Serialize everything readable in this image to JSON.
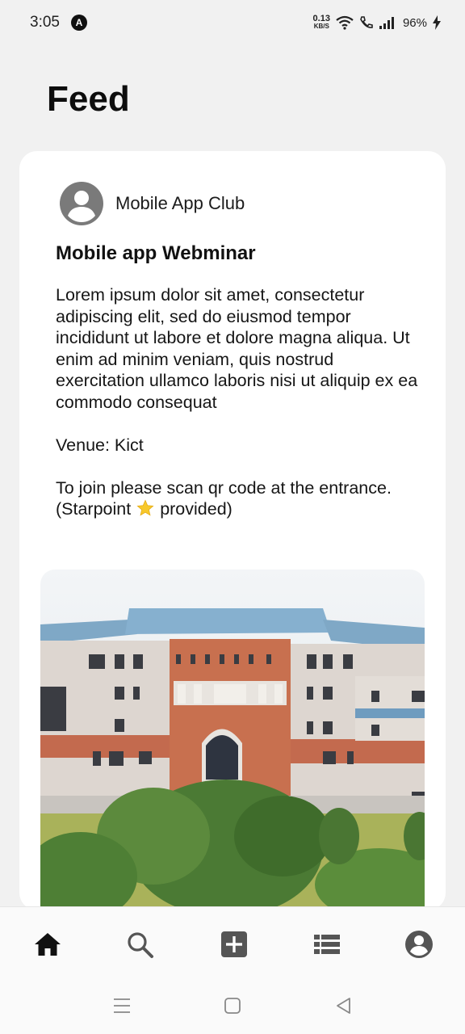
{
  "status_bar": {
    "time": "3:05",
    "app_badge": "A",
    "net_speed_value": "0.13",
    "net_speed_unit": "KB/S",
    "battery": "96%"
  },
  "page": {
    "title": "Feed"
  },
  "post": {
    "author": "Mobile App Club",
    "title": "Mobile app Webminar",
    "body": "Lorem ipsum dolor sit amet, consectetur adipiscing elit, sed do eiusmod tempor incididunt ut labore et dolore magna aliqua. Ut enim ad minim veniam, quis nostrud exercitation ullamco laboris nisi ut aliquip ex ea commodo consequat",
    "venue": "Venue: Kict",
    "join_text": "To join please scan qr code at the entrance.",
    "starpoint_before": "(Starpoint",
    "starpoint_after": "provided)",
    "star_icon": "star-emoji"
  },
  "bottom_nav": {
    "items": [
      {
        "icon": "home-icon",
        "active": true
      },
      {
        "icon": "search-icon",
        "active": false
      },
      {
        "icon": "add-box-icon",
        "active": false
      },
      {
        "icon": "list-icon",
        "active": false
      },
      {
        "icon": "account-icon",
        "active": false
      }
    ]
  },
  "system_nav": [
    "menu-icon",
    "home-square-icon",
    "back-triangle-icon"
  ],
  "colors": {
    "background": "#f1f1f1",
    "card": "#ffffff",
    "icon_gray": "#555555",
    "active_icon": "#111111",
    "star": "#f7c82b"
  }
}
